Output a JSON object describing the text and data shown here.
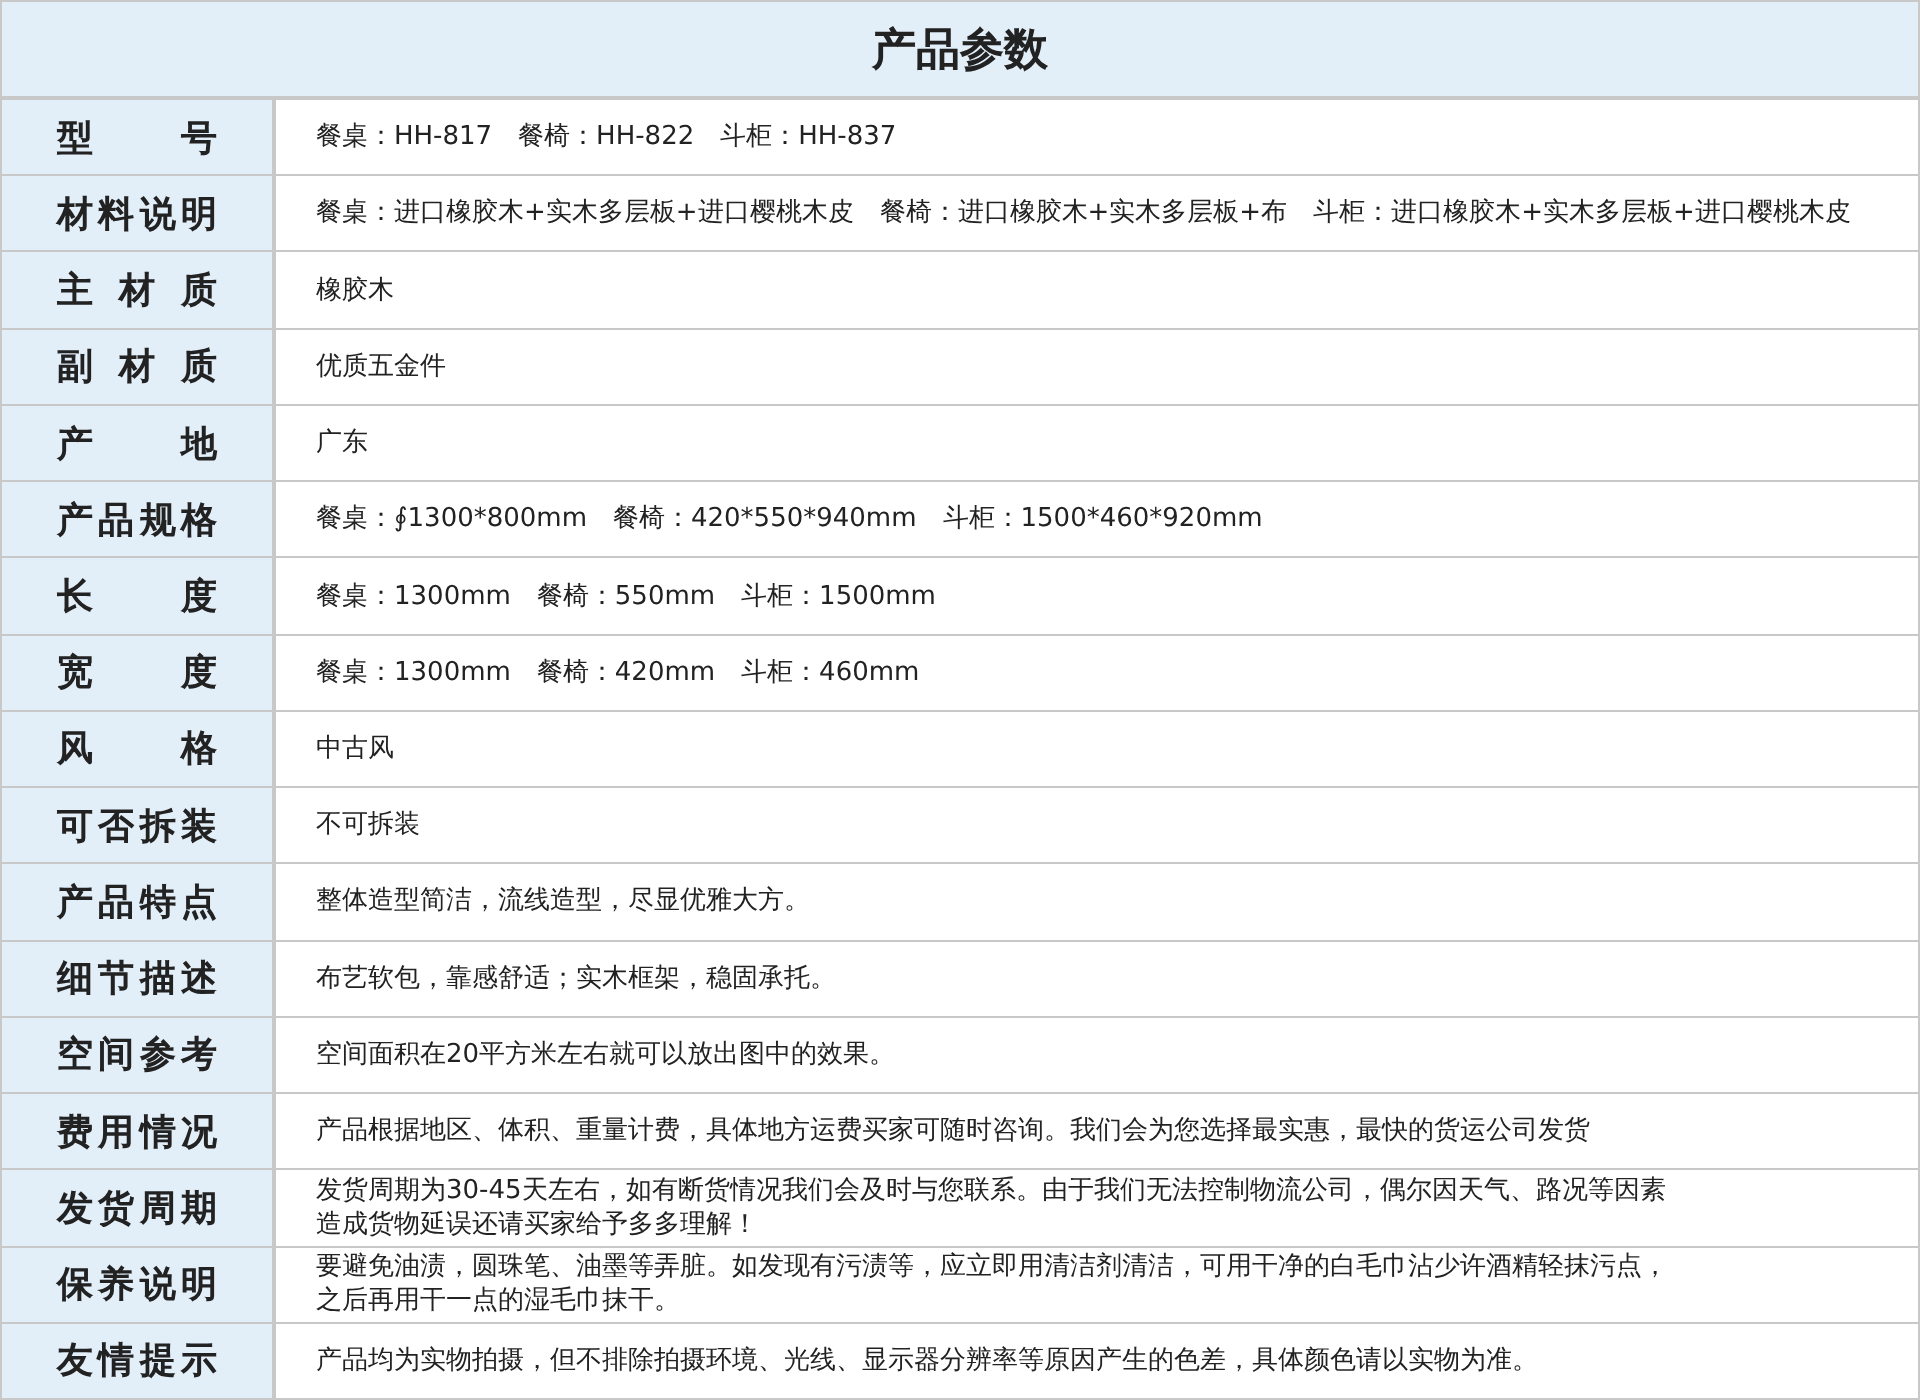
{
  "title": "产品参数",
  "rows": [
    {
      "label": "型 号",
      "value": "餐桌：HH-817　餐椅：HH-822　斗柜：HH-837"
    },
    {
      "label": "材料说明",
      "value": "餐桌：进口橡胶木+实木多层板+进口樱桃木皮　餐椅：进口橡胶木+实木多层板+布　斗柜：进口橡胶木+实木多层板+进口樱桃木皮"
    },
    {
      "label": "主 材 质",
      "value": "橡胶木"
    },
    {
      "label": "副 材 质",
      "value": "优质五金件"
    },
    {
      "label": "产 地",
      "value": "广东"
    },
    {
      "label": "产品规格",
      "value": "餐桌：∮1300*800mm　餐椅：420*550*940mm　斗柜：1500*460*920mm"
    },
    {
      "label": "长 度",
      "value": "餐桌：1300mm　餐椅：550mm　斗柜：1500mm"
    },
    {
      "label": "宽 度",
      "value": "餐桌：1300mm　餐椅：420mm　斗柜：460mm"
    },
    {
      "label": "风 格",
      "value": "中古风"
    },
    {
      "label": "可否拆装",
      "value": "不可拆装"
    },
    {
      "label": "产品特点",
      "value": "整体造型简洁，流线造型，尽显优雅大方。"
    },
    {
      "label": "细节描述",
      "value": "布艺软包，靠感舒适；实木框架，稳固承托。"
    },
    {
      "label": "空间参考",
      "value": "空间面积在20平方米左右就可以放出图中的效果。"
    },
    {
      "label": "费用情况",
      "value": "产品根据地区、体积、重量计费，具体地方运费买家可随时咨询。我们会为您选择最实惠，最快的货运公司发货"
    },
    {
      "label": "发货周期",
      "lines": [
        "发货周期为30-45天左右，如有断货情况我们会及时与您联系。由于我们无法控制物流公司，偶尔因天气、路况等因素",
        "造成货物延误还请买家给予多多理解！"
      ]
    },
    {
      "label": "保养说明",
      "lines": [
        "要避免油渍，圆珠笔、油墨等弄脏。如发现有污渍等，应立即用清洁剂清洁，可用干净的白毛巾沾少许酒精轻抹污点，",
        "之后再用干一点的湿毛巾抹干。"
      ]
    },
    {
      "label": "友情提示",
      "value": "产品均为实物拍摄，但不排除拍摄环境、光线、显示器分辨率等原因产生的色差，具体颜色请以实物为准。"
    }
  ]
}
